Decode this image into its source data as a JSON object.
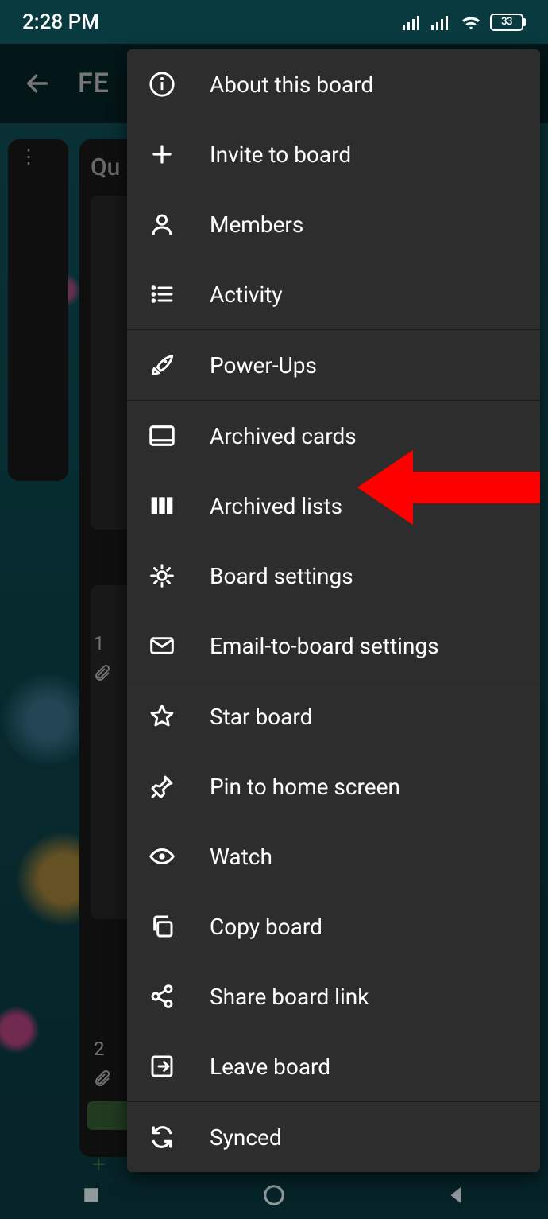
{
  "status": {
    "time": "2:28 PM",
    "battery_pct": "33"
  },
  "board": {
    "title_visible": "FE",
    "list_header_visible": "Qu",
    "card_row_1": "1",
    "card_row_2": "2"
  },
  "menu": {
    "items": [
      {
        "label": "About this board",
        "icon": "info-icon"
      },
      {
        "label": "Invite to board",
        "icon": "plus-icon"
      },
      {
        "label": "Members",
        "icon": "person-icon"
      },
      {
        "label": "Activity",
        "icon": "list-icon"
      }
    ],
    "items2": [
      {
        "label": "Power-Ups",
        "icon": "rocket-icon"
      }
    ],
    "items3": [
      {
        "label": "Archived cards",
        "icon": "archive-card-icon"
      },
      {
        "label": "Archived lists",
        "icon": "columns-icon"
      },
      {
        "label": "Board settings",
        "icon": "gear-icon"
      },
      {
        "label": "Email-to-board settings",
        "icon": "mail-icon"
      }
    ],
    "items4": [
      {
        "label": "Star board",
        "icon": "star-icon"
      },
      {
        "label": "Pin to home screen",
        "icon": "pin-icon"
      },
      {
        "label": "Watch",
        "icon": "eye-icon"
      },
      {
        "label": "Copy board",
        "icon": "copy-icon"
      },
      {
        "label": "Share board link",
        "icon": "share-icon"
      },
      {
        "label": "Leave board",
        "icon": "exit-icon"
      }
    ],
    "items5": [
      {
        "label": "Synced",
        "icon": "sync-icon"
      }
    ]
  },
  "annotation": {
    "target_label": "Archived lists"
  }
}
